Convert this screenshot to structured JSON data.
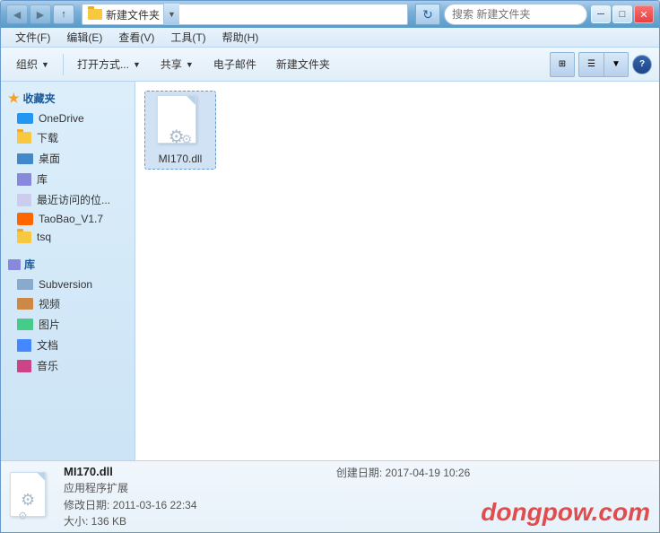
{
  "window": {
    "title": "新建文件夹",
    "titlebar_buttons": {
      "minimize": "─",
      "maximize": "□",
      "close": "✕"
    }
  },
  "addressbar": {
    "path": "新建文件夹",
    "search_placeholder": "搜索 新建文件夹"
  },
  "menubar": {
    "items": [
      "文件(F)",
      "编辑(E)",
      "查看(V)",
      "工具(T)",
      "帮助(H)"
    ]
  },
  "toolbar": {
    "organize": "组织",
    "open_with": "打开方式...",
    "share": "共享",
    "email": "电子邮件",
    "new_folder": "新建文件夹"
  },
  "sidebar": {
    "favorites_label": "收藏夹",
    "items_favorites": [
      {
        "label": "OneDrive",
        "icon": "onedrive"
      },
      {
        "label": "下载",
        "icon": "folder"
      },
      {
        "label": "桌面",
        "icon": "desktop"
      },
      {
        "label": "库",
        "icon": "library"
      },
      {
        "label": "最近访问的位...",
        "icon": "recent"
      },
      {
        "label": "TaoBao_V1.7",
        "icon": "taobao"
      },
      {
        "label": "tsq",
        "icon": "folder"
      }
    ],
    "library_label": "库",
    "items_library": [
      {
        "label": "Subversion",
        "icon": "subversion"
      },
      {
        "label": "视频",
        "icon": "video"
      },
      {
        "label": "图片",
        "icon": "image"
      },
      {
        "label": "文档",
        "icon": "doc"
      },
      {
        "label": "音乐",
        "icon": "music"
      }
    ]
  },
  "files": [
    {
      "name": "MI170.dll",
      "type": "dll"
    }
  ],
  "statusbar": {
    "filename": "MI170.dll",
    "type": "应用程序扩展",
    "modified": "修改日期: 2011-03-16 22:34",
    "size": "大小: 136 KB",
    "created": "创建日期: 2017-04-19 10:26"
  },
  "watermark": "dongpow.com"
}
